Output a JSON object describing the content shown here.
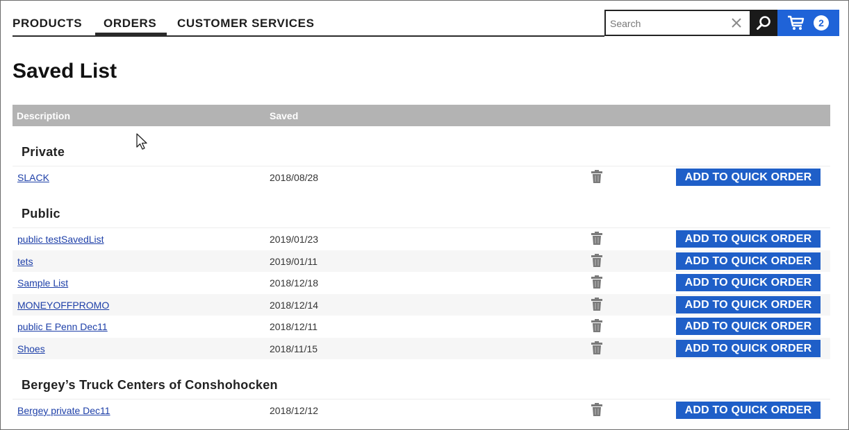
{
  "nav": {
    "items": [
      {
        "label": "PRODUCTS"
      },
      {
        "label": "ORDERS"
      },
      {
        "label": "CUSTOMER SERVICES"
      }
    ],
    "active": "ORDERS"
  },
  "search": {
    "placeholder": "Search",
    "value": ""
  },
  "cart": {
    "count": "2"
  },
  "page": {
    "title": "Saved List"
  },
  "table": {
    "headers": {
      "description": "Description",
      "saved": "Saved"
    }
  },
  "groups": [
    {
      "title": "Private",
      "rows": [
        {
          "name": "SLACK",
          "saved": "2018/08/28",
          "action": "ADD TO QUICK ORDER"
        }
      ]
    },
    {
      "title": "Public",
      "rows": [
        {
          "name": "public testSavedList",
          "saved": "2019/01/23",
          "action": "ADD TO QUICK ORDER"
        },
        {
          "name": "tets",
          "saved": "2019/01/11",
          "action": "ADD TO QUICK ORDER"
        },
        {
          "name": "Sample List",
          "saved": "2018/12/18",
          "action": "ADD TO QUICK ORDER"
        },
        {
          "name": "MONEYOFFPROMO",
          "saved": "2018/12/14",
          "action": "ADD TO QUICK ORDER"
        },
        {
          "name": "public E Penn Dec11",
          "saved": "2018/12/11",
          "action": "ADD TO QUICK ORDER"
        },
        {
          "name": "Shoes",
          "saved": "2018/11/15",
          "action": "ADD TO QUICK ORDER"
        }
      ]
    },
    {
      "title": "Bergey’s Truck Centers of Conshohocken",
      "rows": [
        {
          "name": "Bergey private Dec11",
          "saved": "2018/12/12",
          "action": "ADD TO QUICK ORDER"
        }
      ]
    }
  ],
  "colors": {
    "accent": "#1f63d8",
    "button": "#1f5fc8",
    "link": "#1d3fa8",
    "header_bg": "#b3b3b3"
  },
  "icons": {
    "search": "search-icon",
    "clear": "close-icon",
    "cart": "cart-icon",
    "delete": "trash-icon"
  }
}
